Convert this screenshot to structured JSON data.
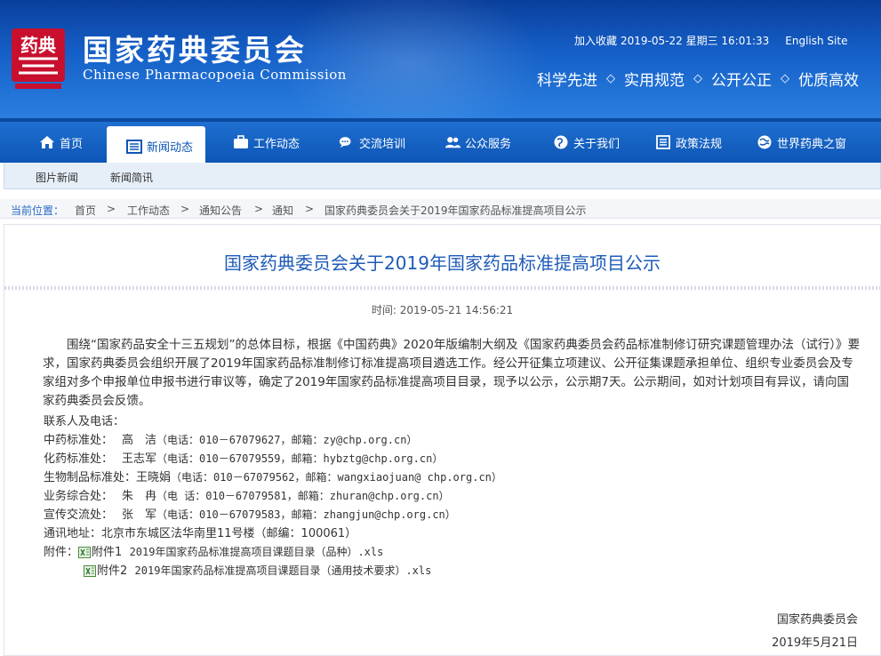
{
  "header": {
    "logo_cn": "国家药典委员会",
    "logo_en": "Chinese Pharmacopoeia Commission",
    "logo_mark_text": "药典",
    "bookmark": "加入收藏",
    "datetime": "2019-05-22 星期三 16:01:33",
    "english_site": "English Site",
    "slogans": [
      "科学先进",
      "实用规范",
      "公开公正",
      "优质高效"
    ]
  },
  "nav": {
    "items": [
      {
        "label": "首页",
        "icon": "home-icon"
      },
      {
        "label": "新闻动态",
        "icon": "news-icon"
      },
      {
        "label": "工作动态",
        "icon": "briefcase-icon"
      },
      {
        "label": "交流培训",
        "icon": "chat-icon"
      },
      {
        "label": "公众服务",
        "icon": "people-icon"
      },
      {
        "label": "关于我们",
        "icon": "globe-icon"
      },
      {
        "label": "政策法规",
        "icon": "document-icon"
      },
      {
        "label": "世界药典之窗",
        "icon": "world-icon"
      }
    ],
    "active_index": 1
  },
  "subnav": {
    "items": [
      "图片新闻",
      "新闻简讯"
    ]
  },
  "breadcrumb": {
    "label": "当前位置：",
    "items": [
      "首页",
      "工作动态",
      "通知公告",
      "通知",
      "国家药典委员会关于2019年国家药品标准提高项目公示"
    ],
    "separator": ">"
  },
  "article": {
    "title": "国家药典委员会关于2019年国家药品标准提高项目公示",
    "time": "时间: 2019-05-21 14:56:21",
    "paragraph": "围绕“国家药品安全十三五规划”的总体目标，根据《中国药典》2020年版编制大纲及《国家药典委员会药品标准制修订研究课题管理办法（试行）》要求，国家药典委员会组织开展了2019年国家药品标准制修订标准提高项目遴选工作。经公开征集立项建议、公开征集课题承担单位、组织专业委员会及专家组对多个申报单位申报书进行审议等，确定了2019年国家药品标准提高项目目录，现予以公示，公示期7天。公示期间，如对计划项目有异议，请向国家药典委员会反馈。",
    "contacts_heading": "联系人及电话：",
    "contacts": [
      {
        "dept": "中药标准处：",
        "name": "高　洁",
        "phone": "（电话：010－67079627，邮箱：zy@chp.org.cn）"
      },
      {
        "dept": "化药标准处：",
        "name": "王志军",
        "phone": "（电话：010－67079559，邮箱：hybztg@chp.org.cn）"
      },
      {
        "dept": "生物制品标准处：",
        "name": "王晓娟",
        "phone": "（电话：010－67079562，邮箱：wangxiaojuan@ chp.org.cn）"
      },
      {
        "dept": "业务综合处：",
        "name": "朱　冉",
        "phone": "（电 话：010－67079581，邮箱：zhuran@chp.org.cn）"
      },
      {
        "dept": "宣传交流处：",
        "name": "张　军",
        "phone": "（电话：010－67079583，邮箱：zhangjun@chp.org.cn）"
      }
    ],
    "address": "通讯地址：北京市东城区法华南里11号楼（邮编：100061）",
    "attachments_label": "附件：",
    "attachments": [
      {
        "label": "附件1",
        "name": "2019年国家药品标准提高项目课题目录（品种）.xls"
      },
      {
        "label": "附件2",
        "name": "2019年国家药品标准提高项目课题目录（通用技术要求）.xls"
      }
    ],
    "signature": "国家药典委员会",
    "sign_date": "2019年5月21日"
  },
  "colors": {
    "brand_blue": "#0d56b6",
    "title_blue": "#1e5bb8"
  }
}
